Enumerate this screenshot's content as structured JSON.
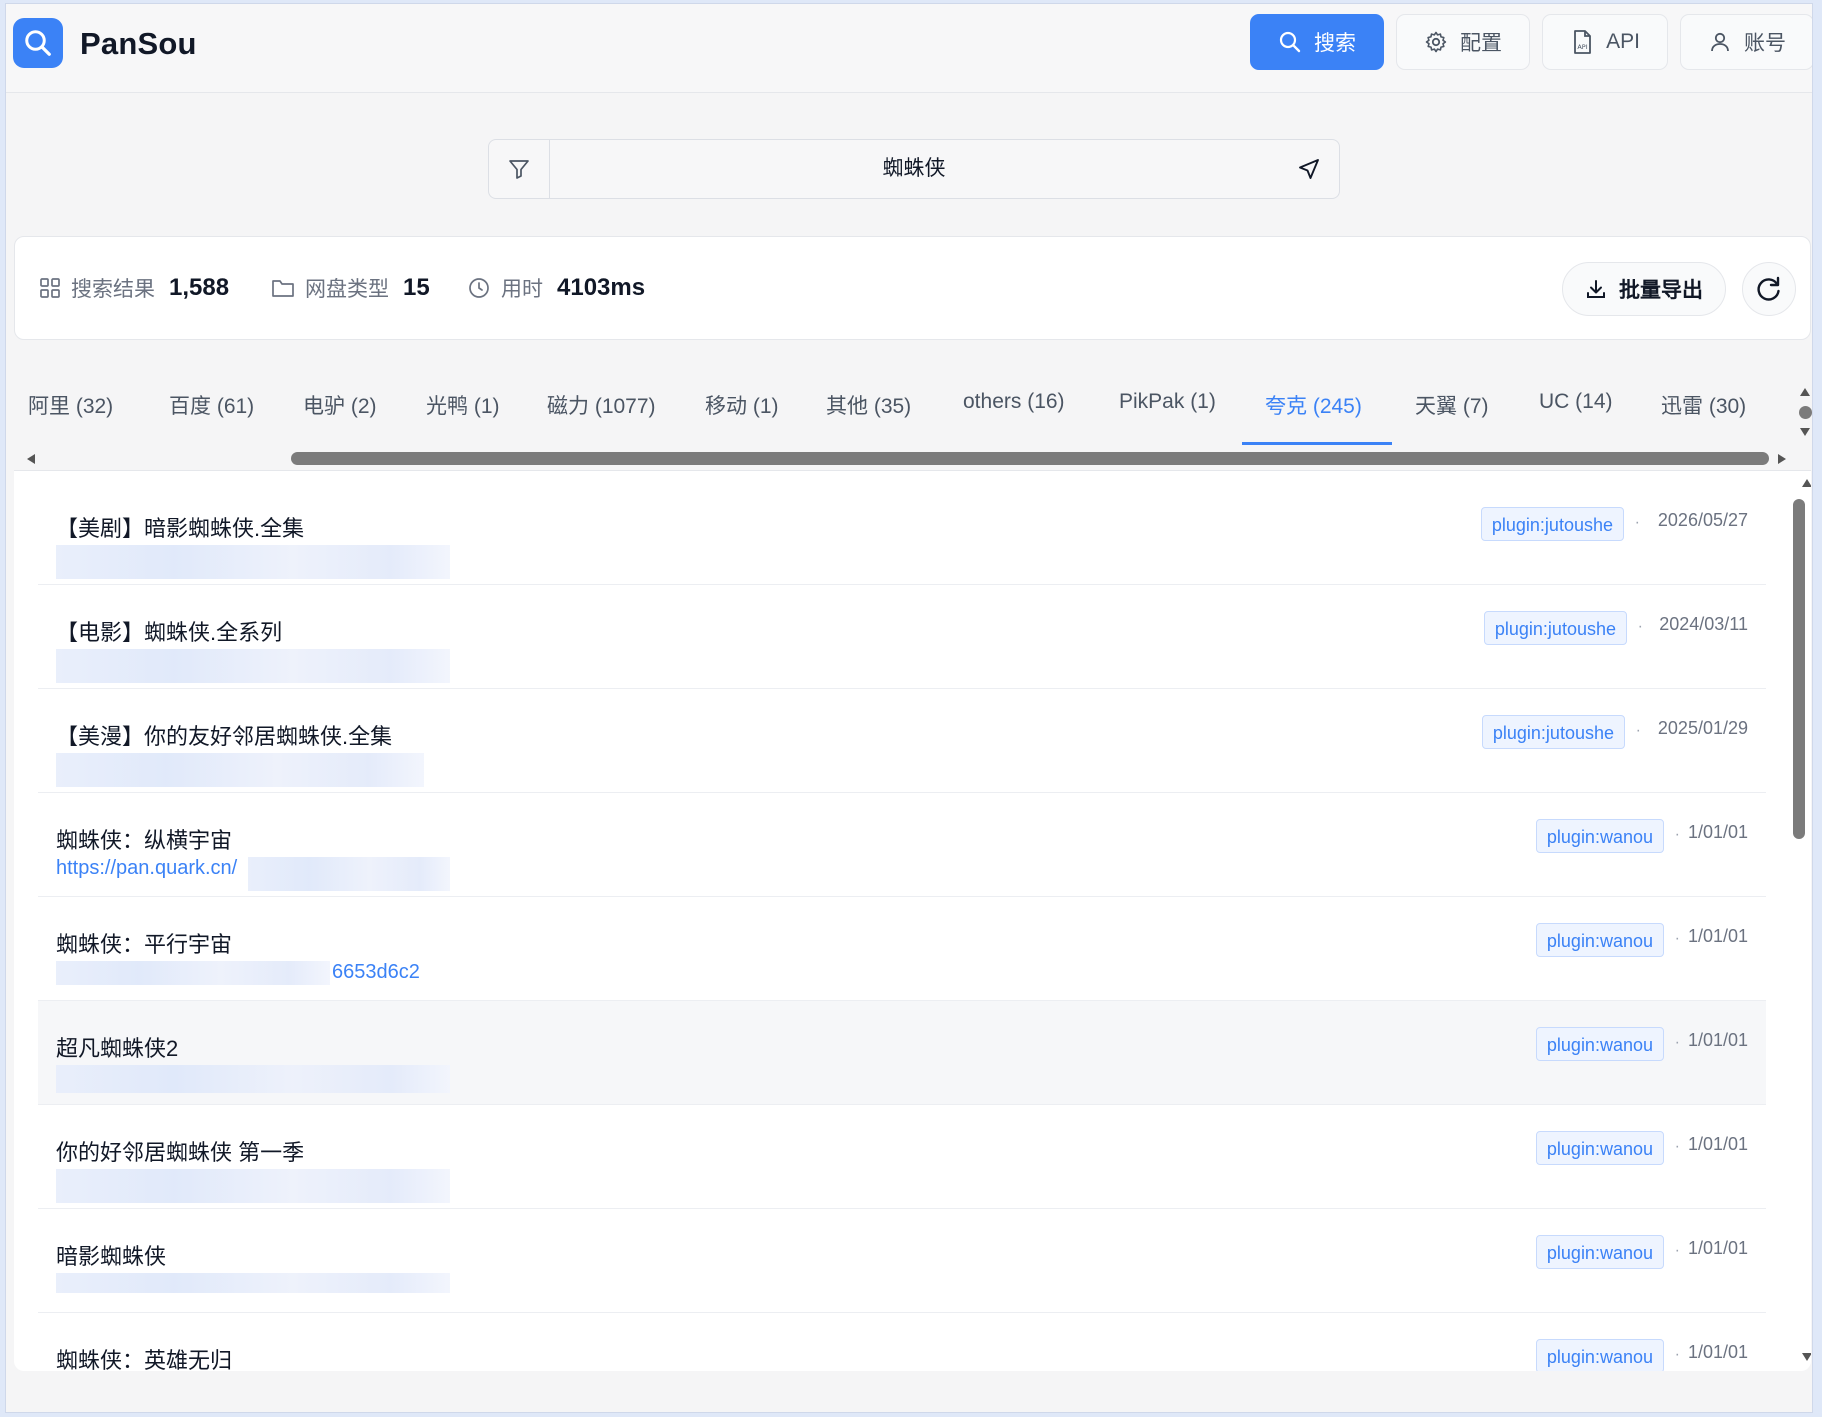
{
  "app": {
    "name": "PanSou"
  },
  "nav": {
    "search": "搜索",
    "settings": "配置",
    "api": "API",
    "account": "账号"
  },
  "search": {
    "query": "蜘蛛侠"
  },
  "stats": {
    "results_label": "搜索结果",
    "results_value": "1,588",
    "types_label": "网盘类型",
    "types_value": "15",
    "time_label": "用时",
    "time_value": "4103ms",
    "export_label": "批量导出"
  },
  "tabs": [
    {
      "label": "阿里 (32)"
    },
    {
      "label": "百度 (61)"
    },
    {
      "label": "电驴 (2)"
    },
    {
      "label": "光鸭 (1)"
    },
    {
      "label": "磁力 (1077)"
    },
    {
      "label": "移动 (1)"
    },
    {
      "label": "其他 (35)"
    },
    {
      "label": "others (16)"
    },
    {
      "label": "PikPak (1)"
    },
    {
      "label": "夸克 (245)"
    },
    {
      "label": "天翼 (7)"
    },
    {
      "label": "UC (14)"
    },
    {
      "label": "迅雷 (30)"
    }
  ],
  "active_tab": "夸克 (245)",
  "results": [
    {
      "title": "【美剧】暗影蜘蛛侠.全集",
      "link": "",
      "source": "plugin:jutoushe",
      "date": "2026/05/27"
    },
    {
      "title": "【电影】蜘蛛侠.全系列",
      "link": "",
      "source": "plugin:jutoushe",
      "date": "2024/03/11"
    },
    {
      "title": "【美漫】你的友好邻居蜘蛛侠.全集",
      "link": "",
      "source": "plugin:jutoushe",
      "date": "2025/01/29"
    },
    {
      "title": "蜘蛛侠：纵横宇宙",
      "link": "https://pan.quark.cn/",
      "source": "plugin:wanou",
      "date": "1/01/01"
    },
    {
      "title": "蜘蛛侠：平行宇宙",
      "link": "6653d6c2",
      "source": "plugin:wanou",
      "date": "1/01/01"
    },
    {
      "title": "超凡蜘蛛侠2",
      "link": "",
      "source": "plugin:wanou",
      "date": "1/01/01"
    },
    {
      "title": "你的好邻居蜘蛛侠 第一季",
      "link": "",
      "source": "plugin:wanou",
      "date": "1/01/01"
    },
    {
      "title": "暗影蜘蛛侠",
      "link": "",
      "source": "plugin:wanou",
      "date": "1/01/01"
    },
    {
      "title": "蜘蛛侠：英雄无归",
      "link": "",
      "source": "plugin:wanou",
      "date": "1/01/01"
    }
  ],
  "colors": {
    "accent": "#3b82f6",
    "badge_bg": "#eef4ff",
    "page_bg": "#f5f5f6"
  },
  "icons": {
    "logo": "search-icon",
    "search": "search-icon",
    "settings": "gear-icon",
    "api": "document-icon",
    "account": "user-icon",
    "filter": "filter-icon",
    "send": "send-icon",
    "results": "grid-icon",
    "types": "folder-icon",
    "time": "clock-icon",
    "export": "download-icon",
    "refresh": "refresh-icon"
  }
}
